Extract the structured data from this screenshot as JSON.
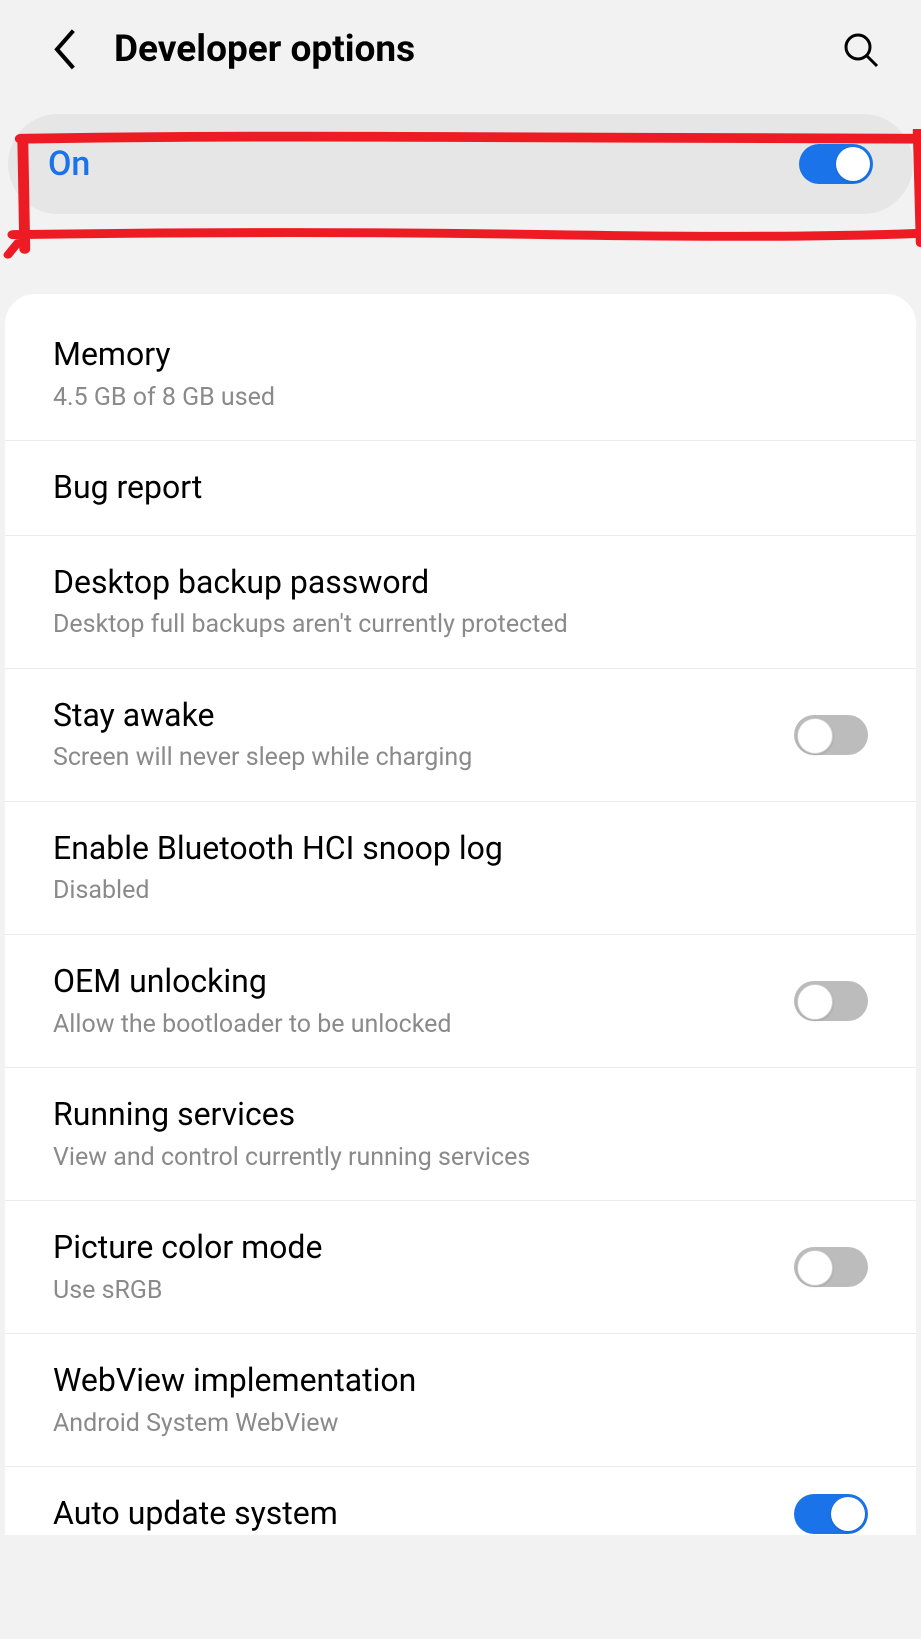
{
  "header": {
    "title": "Developer options"
  },
  "master": {
    "label": "On",
    "enabled": true
  },
  "items": [
    {
      "title": "Memory",
      "sub": "4.5 GB of 8 GB used",
      "toggle": null
    },
    {
      "title": "Bug report",
      "sub": null,
      "toggle": null
    },
    {
      "title": "Desktop backup password",
      "sub": "Desktop full backups aren't currently protected",
      "toggle": null
    },
    {
      "title": "Stay awake",
      "sub": "Screen will never sleep while charging",
      "toggle": false
    },
    {
      "title": "Enable Bluetooth HCI snoop log",
      "sub": "Disabled",
      "toggle": null
    },
    {
      "title": "OEM unlocking",
      "sub": "Allow the bootloader to be unlocked",
      "toggle": false
    },
    {
      "title": "Running services",
      "sub": "View and control currently running services",
      "toggle": null
    },
    {
      "title": "Picture color mode",
      "sub": "Use sRGB",
      "toggle": false
    },
    {
      "title": "WebView implementation",
      "sub": "Android System WebView",
      "toggle": null
    }
  ],
  "partial": {
    "title": "Auto update system",
    "toggle": true
  },
  "annotation": {
    "color": "#ed1c24"
  }
}
